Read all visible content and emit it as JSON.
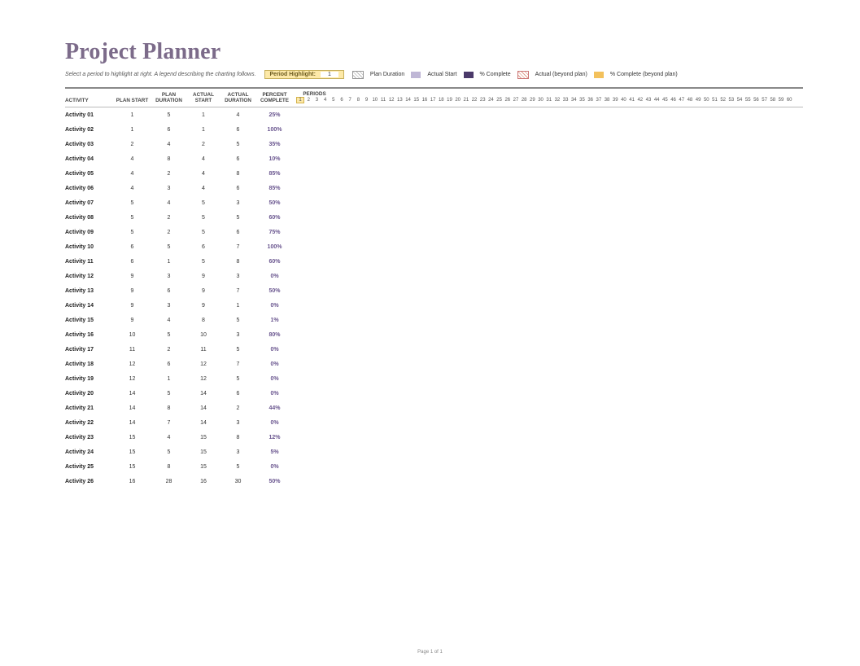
{
  "title": "Project Planner",
  "subtext": "Select a period to highlight at right. A legend describing the charting follows.",
  "periodHighlight": {
    "label": "Period Highlight:",
    "value": "1"
  },
  "legend": [
    {
      "swatch": "sw-plan",
      "label": "Plan Duration"
    },
    {
      "swatch": "sw-actual-start",
      "label": "Actual Start"
    },
    {
      "swatch": "sw-complete",
      "label": "% Complete"
    },
    {
      "swatch": "sw-beyond",
      "label": "Actual (beyond plan)"
    },
    {
      "swatch": "sw-beyond-c",
      "label": "% Complete (beyond plan)"
    }
  ],
  "columns": {
    "activity": "ACTIVITY",
    "planStart": "PLAN START",
    "planDuration": "PLAN DURATION",
    "actualStart": "ACTUAL START",
    "actualDuration": "ACTUAL DURATION",
    "percentComplete": "PERCENT COMPLETE",
    "periods": "PERIODS"
  },
  "periodCount": 60,
  "highlightedPeriod": 1,
  "rows": [
    {
      "activity": "Activity 01",
      "ps": "1",
      "pd": "5",
      "as": "1",
      "ad": "4",
      "pc": "25%"
    },
    {
      "activity": "Activity 02",
      "ps": "1",
      "pd": "6",
      "as": "1",
      "ad": "6",
      "pc": "100%"
    },
    {
      "activity": "Activity 03",
      "ps": "2",
      "pd": "4",
      "as": "2",
      "ad": "5",
      "pc": "35%"
    },
    {
      "activity": "Activity 04",
      "ps": "4",
      "pd": "8",
      "as": "4",
      "ad": "6",
      "pc": "10%"
    },
    {
      "activity": "Activity 05",
      "ps": "4",
      "pd": "2",
      "as": "4",
      "ad": "8",
      "pc": "85%"
    },
    {
      "activity": "Activity 06",
      "ps": "4",
      "pd": "3",
      "as": "4",
      "ad": "6",
      "pc": "85%"
    },
    {
      "activity": "Activity 07",
      "ps": "5",
      "pd": "4",
      "as": "5",
      "ad": "3",
      "pc": "50%"
    },
    {
      "activity": "Activity 08",
      "ps": "5",
      "pd": "2",
      "as": "5",
      "ad": "5",
      "pc": "60%"
    },
    {
      "activity": "Activity 09",
      "ps": "5",
      "pd": "2",
      "as": "5",
      "ad": "6",
      "pc": "75%"
    },
    {
      "activity": "Activity 10",
      "ps": "6",
      "pd": "5",
      "as": "6",
      "ad": "7",
      "pc": "100%"
    },
    {
      "activity": "Activity 11",
      "ps": "6",
      "pd": "1",
      "as": "5",
      "ad": "8",
      "pc": "60%"
    },
    {
      "activity": "Activity 12",
      "ps": "9",
      "pd": "3",
      "as": "9",
      "ad": "3",
      "pc": "0%"
    },
    {
      "activity": "Activity 13",
      "ps": "9",
      "pd": "6",
      "as": "9",
      "ad": "7",
      "pc": "50%"
    },
    {
      "activity": "Activity 14",
      "ps": "9",
      "pd": "3",
      "as": "9",
      "ad": "1",
      "pc": "0%"
    },
    {
      "activity": "Activity 15",
      "ps": "9",
      "pd": "4",
      "as": "8",
      "ad": "5",
      "pc": "1%"
    },
    {
      "activity": "Activity 16",
      "ps": "10",
      "pd": "5",
      "as": "10",
      "ad": "3",
      "pc": "80%"
    },
    {
      "activity": "Activity 17",
      "ps": "11",
      "pd": "2",
      "as": "11",
      "ad": "5",
      "pc": "0%"
    },
    {
      "activity": "Activity 18",
      "ps": "12",
      "pd": "6",
      "as": "12",
      "ad": "7",
      "pc": "0%"
    },
    {
      "activity": "Activity 19",
      "ps": "12",
      "pd": "1",
      "as": "12",
      "ad": "5",
      "pc": "0%"
    },
    {
      "activity": "Activity 20",
      "ps": "14",
      "pd": "5",
      "as": "14",
      "ad": "6",
      "pc": "0%"
    },
    {
      "activity": "Activity 21",
      "ps": "14",
      "pd": "8",
      "as": "14",
      "ad": "2",
      "pc": "44%"
    },
    {
      "activity": "Activity 22",
      "ps": "14",
      "pd": "7",
      "as": "14",
      "ad": "3",
      "pc": "0%"
    },
    {
      "activity": "Activity 23",
      "ps": "15",
      "pd": "4",
      "as": "15",
      "ad": "8",
      "pc": "12%"
    },
    {
      "activity": "Activity 24",
      "ps": "15",
      "pd": "5",
      "as": "15",
      "ad": "3",
      "pc": "5%"
    },
    {
      "activity": "Activity 25",
      "ps": "15",
      "pd": "8",
      "as": "15",
      "ad": "5",
      "pc": "0%"
    },
    {
      "activity": "Activity 26",
      "ps": "16",
      "pd": "28",
      "as": "16",
      "ad": "30",
      "pc": "50%"
    }
  ],
  "footer": "Page 1 of 1"
}
